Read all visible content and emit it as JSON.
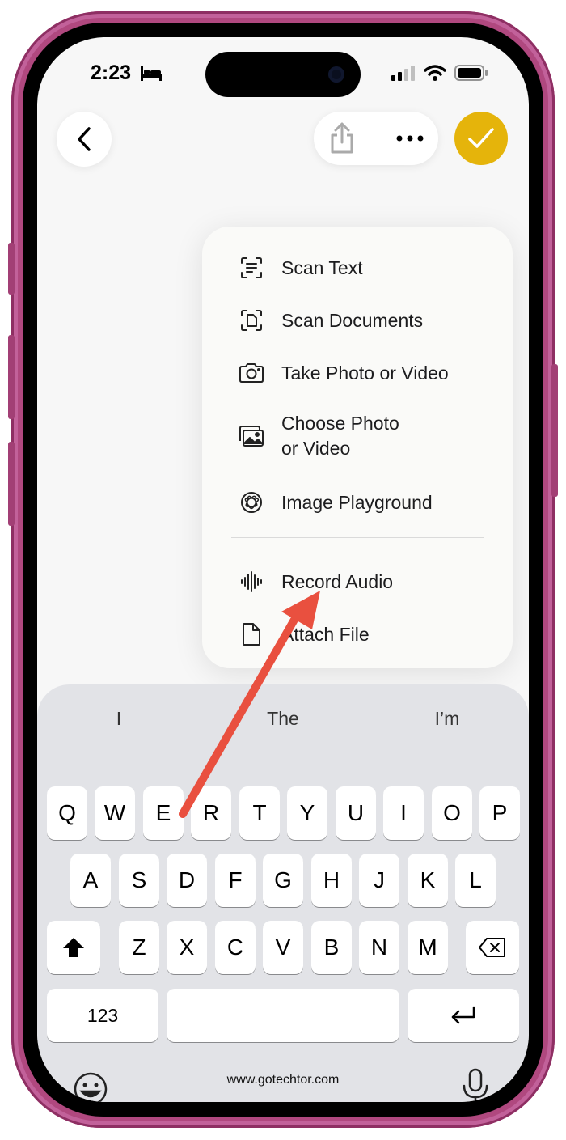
{
  "status": {
    "time": "2:23"
  },
  "menu": {
    "items": [
      {
        "label": "Scan Text",
        "icon": "scan-text-icon"
      },
      {
        "label": "Scan Documents",
        "icon": "scan-documents-icon"
      },
      {
        "label": "Take Photo or Video",
        "icon": "camera-icon"
      },
      {
        "label": "Choose Photo\nor Video",
        "icon": "photo-library-icon"
      },
      {
        "label": "Image Playground",
        "icon": "image-playground-icon"
      },
      {
        "label": "Record Audio",
        "icon": "waveform-icon"
      },
      {
        "label": "Attach File",
        "icon": "document-icon"
      }
    ]
  },
  "keyboard": {
    "suggestions": [
      "I",
      "The",
      "I’m"
    ],
    "row1": [
      "Q",
      "W",
      "E",
      "R",
      "T",
      "Y",
      "U",
      "I",
      "O",
      "P"
    ],
    "row2": [
      "A",
      "S",
      "D",
      "F",
      "G",
      "H",
      "J",
      "K",
      "L"
    ],
    "row3": [
      "Z",
      "X",
      "C",
      "V",
      "B",
      "N",
      "M"
    ],
    "numbers_label": "123"
  },
  "watermark": "www.gotechtor.com",
  "colors": {
    "accent": "#e5b40b",
    "frame": "#b0487f",
    "arrow": "#e9503f"
  }
}
